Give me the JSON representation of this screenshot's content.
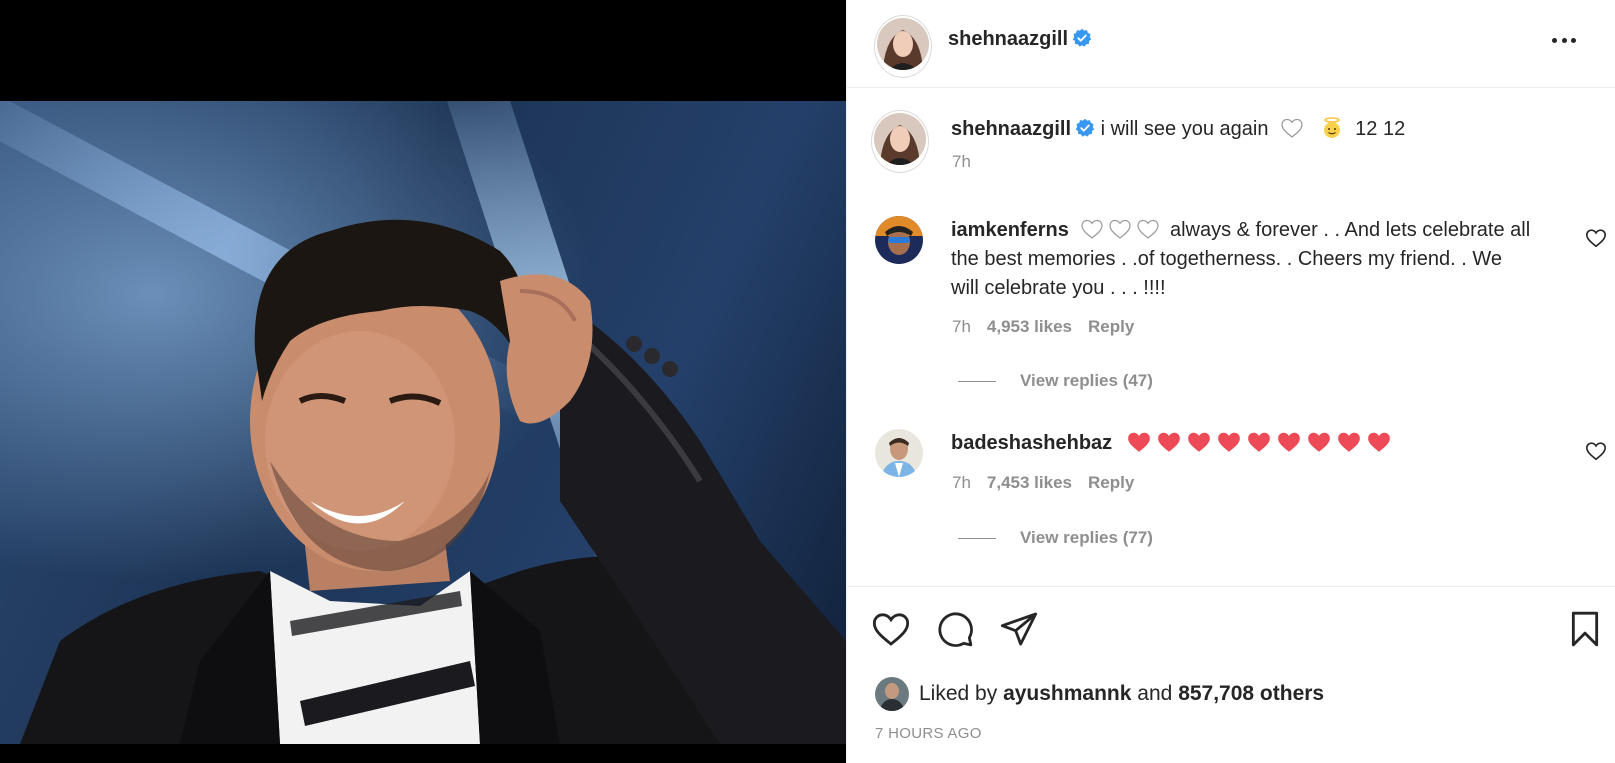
{
  "post": {
    "author": "shehnaazgill",
    "verified": true,
    "caption": "i will see you again",
    "caption_suffix": "12 12",
    "caption_time": "7h",
    "icons": [
      "white-heart-emoji",
      "angel-emoji",
      "verified-badge-icon",
      "more-options-icon"
    ]
  },
  "comments": [
    {
      "username": "iamkenferns",
      "text": "always & forever . . And lets celebrate all the best memories . .of togetherness. . Cheers my friend. . We will celebrate you . . . !!!!",
      "hearts_prefix": 3,
      "time": "7h",
      "likes": "4,953 likes",
      "reply_label": "Reply",
      "view_replies": "View replies (47)"
    },
    {
      "username": "badeshashehbaz",
      "text": "",
      "red_hearts": 9,
      "time": "7h",
      "likes": "7,453 likes",
      "reply_label": "Reply",
      "view_replies": "View replies (77)"
    }
  ],
  "footer": {
    "liked_by_prefix": "Liked by",
    "liked_by_user": "ayushmannk",
    "liked_by_and": "and",
    "liked_by_others": "857,708 others",
    "timestamp": "7 HOURS AGO"
  },
  "colors": {
    "verified_blue": "#3897f0",
    "text": "#262626",
    "muted": "#8e8e8e",
    "heart_red": "#ed4956",
    "divider": "#efefef"
  }
}
